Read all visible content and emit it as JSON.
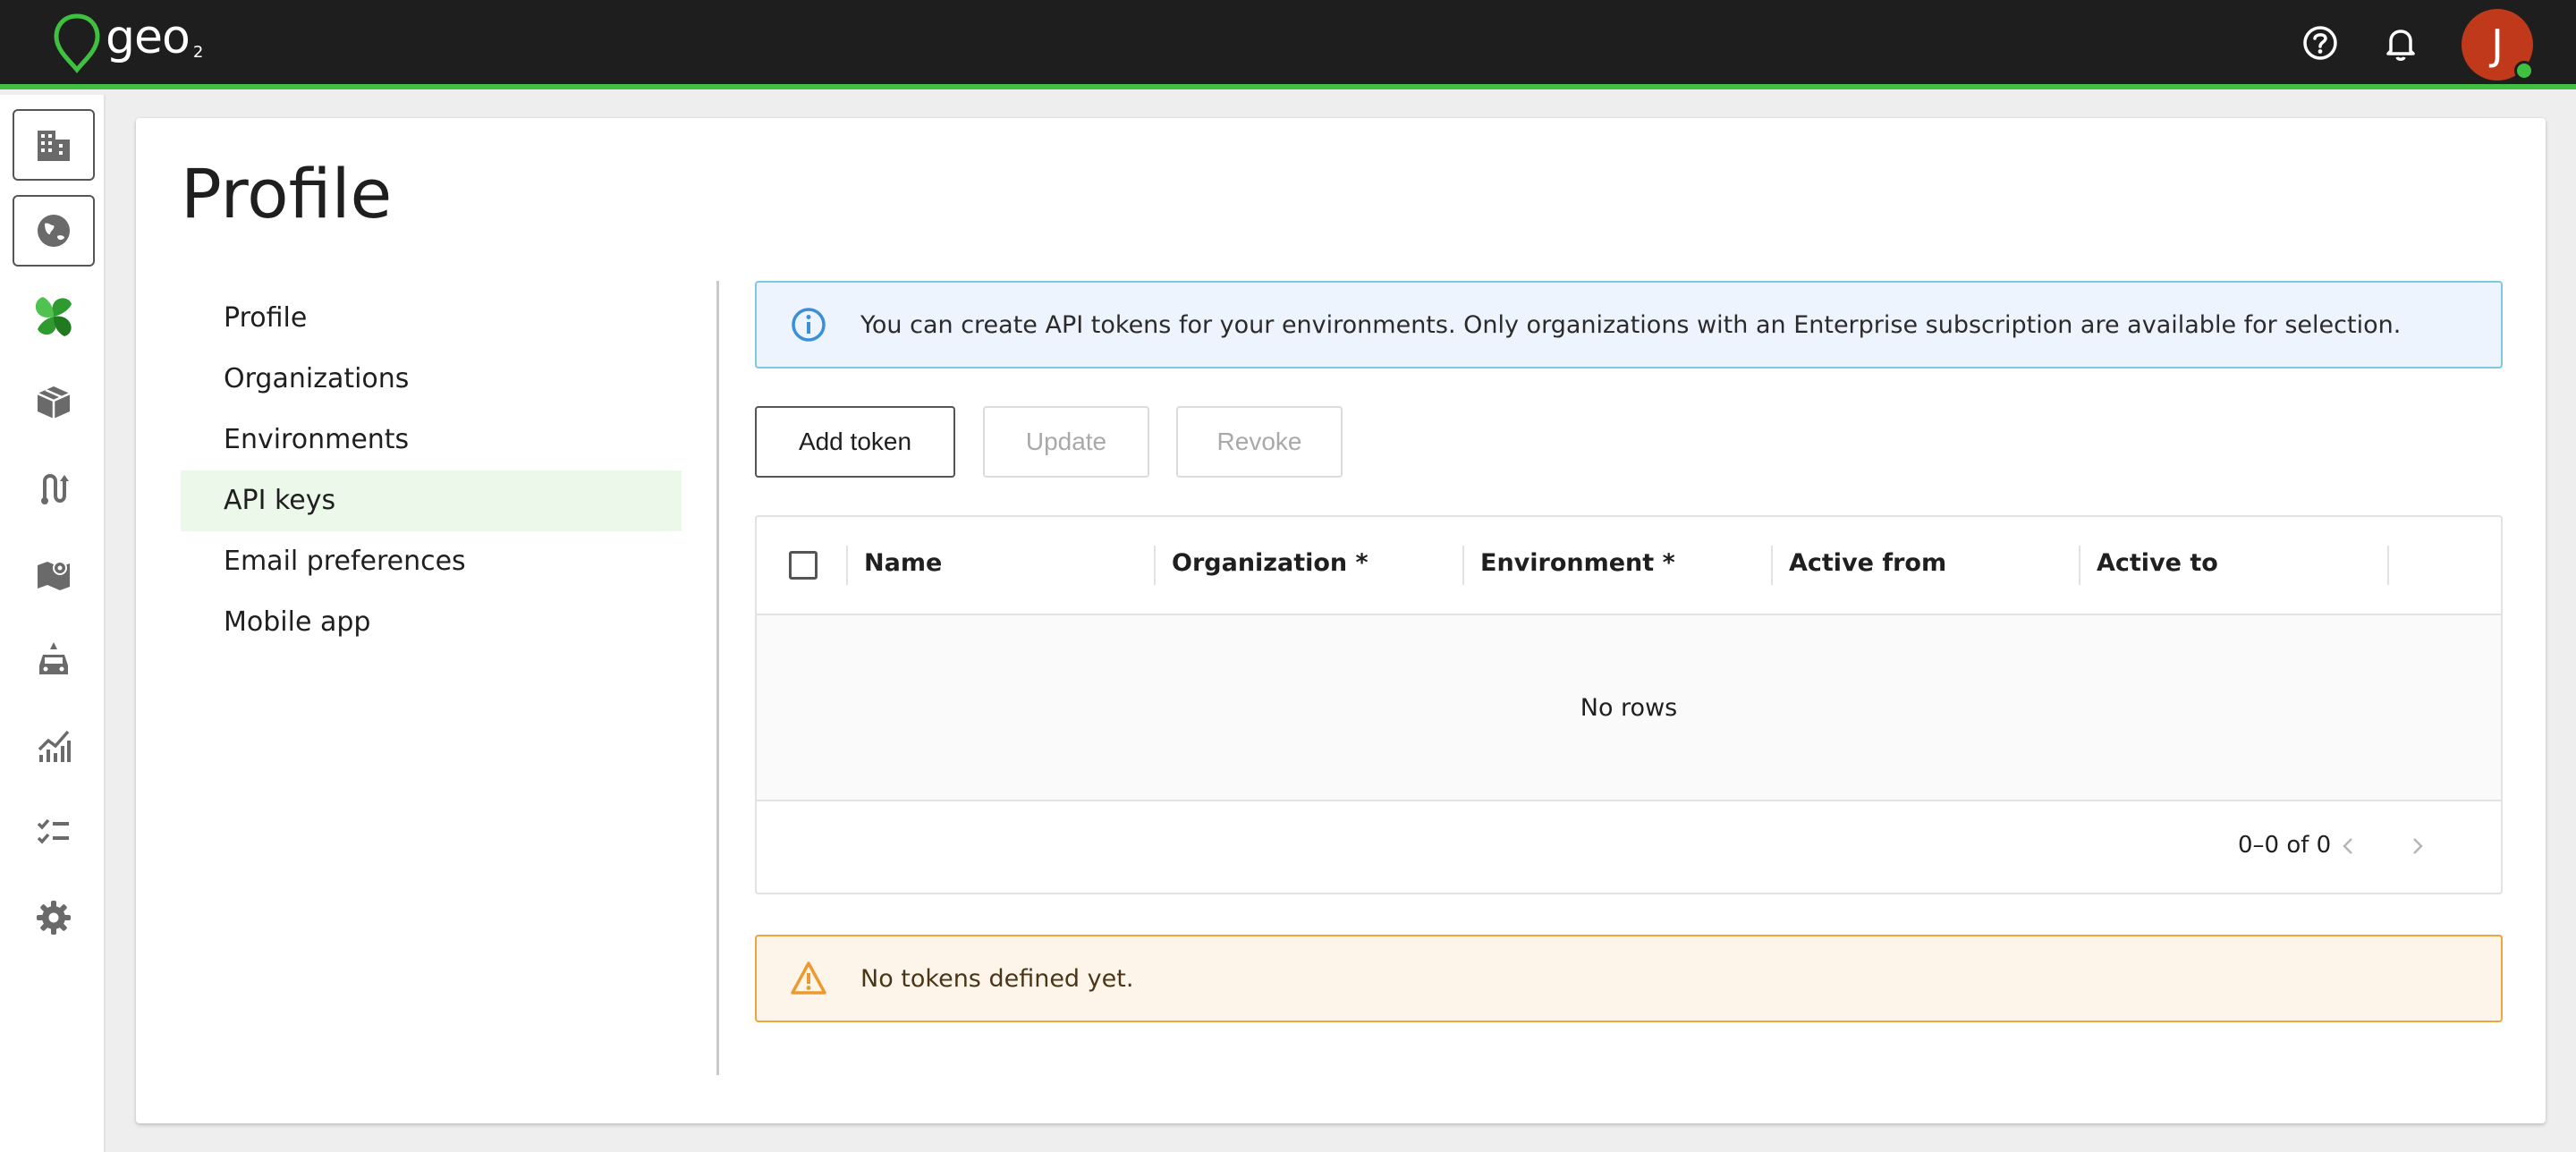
{
  "topbar": {
    "logo_text": "geo",
    "logo_sub": "2",
    "help_icon": "help-circle-icon",
    "notifications_icon": "bell-icon",
    "avatar_initial": "J",
    "accent_color": "#3fc041"
  },
  "rail": {
    "items": [
      {
        "icon": "building-icon"
      },
      {
        "icon": "globe-icon"
      },
      {
        "icon": "leaf-logo-icon"
      },
      {
        "icon": "package-icon"
      },
      {
        "icon": "route-icon"
      },
      {
        "icon": "map-icon"
      },
      {
        "icon": "vehicle-icon"
      },
      {
        "icon": "analytics-icon"
      },
      {
        "icon": "checklist-icon"
      },
      {
        "icon": "settings-gear-icon"
      }
    ]
  },
  "page": {
    "title": "Profile"
  },
  "subnav": {
    "items": [
      {
        "label": "Profile"
      },
      {
        "label": "Organizations"
      },
      {
        "label": "Environments"
      },
      {
        "label": "API keys",
        "active": true
      },
      {
        "label": "Email preferences"
      },
      {
        "label": "Mobile app"
      }
    ]
  },
  "info_alert": {
    "text": "You can create API tokens for your environments. Only organizations with an Enterprise subscription are available for selection.",
    "icon": "info-icon",
    "color": "#7ec9e0"
  },
  "actions": {
    "add_label": "Add token",
    "update_label": "Update",
    "revoke_label": "Revoke"
  },
  "table": {
    "columns": [
      "Name",
      "Organization *",
      "Environment *",
      "Active from",
      "Active to"
    ],
    "empty_text": "No rows",
    "pagination_text": "0–0 of 0"
  },
  "warning_alert": {
    "text": "No tokens defined yet.",
    "icon": "warning-icon",
    "color": "#f0a43b"
  }
}
